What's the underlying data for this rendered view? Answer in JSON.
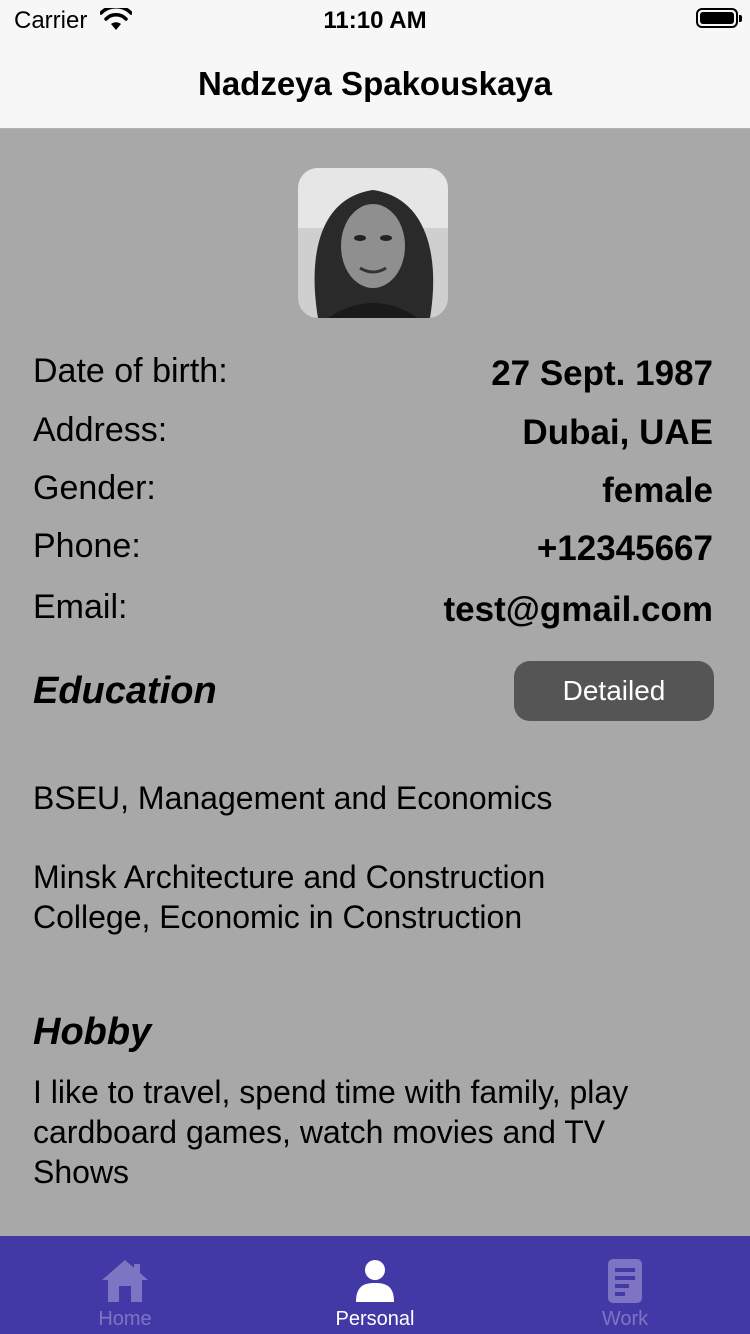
{
  "status": {
    "carrier": "Carrier",
    "time": "11:10 AM"
  },
  "nav": {
    "title": "Nadzeya Spakouskaya"
  },
  "profile": {
    "rows": [
      {
        "label": "Date of birth:",
        "value": "27 Sept. 1987"
      },
      {
        "label": "Address:",
        "value": "Dubai, UAE"
      },
      {
        "label": "Gender:",
        "value": "female"
      },
      {
        "label": "Phone:",
        "value": "+12345667"
      },
      {
        "label": "Email:",
        "value": "test@gmail.com"
      }
    ]
  },
  "education": {
    "heading": "Education",
    "button": "Detailed",
    "items": [
      "BSEU, Management and Economics",
      "Minsk Architecture and Construction College, Economic in Construction"
    ]
  },
  "hobby": {
    "heading": "Hobby",
    "text": "I like to travel, spend time with family, play cardboard games, watch movies and TV Shows"
  },
  "tabs": [
    {
      "label": "Home",
      "icon": "home-icon",
      "active": false
    },
    {
      "label": "Personal",
      "icon": "person-icon",
      "active": true
    },
    {
      "label": "Work",
      "icon": "document-icon",
      "active": false
    }
  ],
  "colors": {
    "background": "#a8a8a8",
    "tab_bar": "#4238a6",
    "button": "#555555",
    "tab_inactive": "#7d75c3"
  }
}
